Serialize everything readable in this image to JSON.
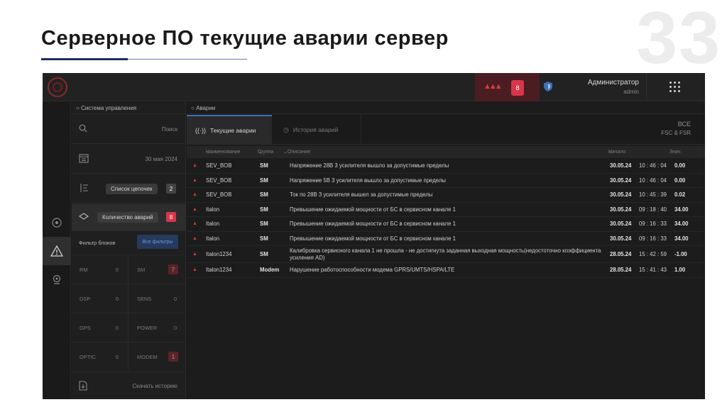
{
  "slide": {
    "title": "Серверное ПО текущие аварии сервер",
    "number": "33"
  },
  "topbar": {
    "alarm_count": "8",
    "user_name": "Администратор",
    "user_role": "admin"
  },
  "sidebar": {
    "header": "Система управления",
    "search_label": "Поиск",
    "date": "30 мая 2024",
    "chain_list_label": "Список цепочек",
    "chain_list_count": "2",
    "alarm_count_label": "Количество аварий",
    "alarm_count_value": "8",
    "block_filter_label": "Фильтр блоков",
    "all_filters_label": "Все фильтры",
    "blocks": [
      {
        "name": "RM",
        "value": "0"
      },
      {
        "name": "SM",
        "value": "7"
      },
      {
        "name": "DSP",
        "value": "0"
      },
      {
        "name": "SENS",
        "value": "0"
      },
      {
        "name": "GPS",
        "value": "0"
      },
      {
        "name": "POWER",
        "value": "0"
      },
      {
        "name": "OPTIC",
        "value": "0"
      },
      {
        "name": "MODEM",
        "value": "1"
      }
    ],
    "download_history_label": "Скачать историю"
  },
  "main": {
    "header": "Аварии",
    "tab_current": "Текущие аварии",
    "tab_history": "История аварий",
    "filter_line1": "ВСЕ",
    "filter_line2": "FSC & FSR",
    "columns": {
      "name": "Наименование",
      "group": "Группа",
      "description": "Описание",
      "start": "Начало",
      "value": "Знач."
    },
    "rows": [
      {
        "name": "SEV_BOB",
        "group": "SM",
        "description": "Напряжение 28В 3 усилителя вышло за допустимые пределы",
        "date": "30.05.24",
        "time": "10 : 46 : 04",
        "value": "0.00"
      },
      {
        "name": "SEV_BOB",
        "group": "SM",
        "description": "Напряжение 5В 3 усилителя вышло за допустимые пределы",
        "date": "30.05.24",
        "time": "10 : 46 : 04",
        "value": "0.00"
      },
      {
        "name": "SEV_BOB",
        "group": "SM",
        "description": "Ток по 28В 3 усилителя вышел за допустимые пределы",
        "date": "30.05.24",
        "time": "10 : 45 : 39",
        "value": "0.02"
      },
      {
        "name": "Italon",
        "group": "SM",
        "description": "Превышение ожидаемой мощности от БС в сервисном канале 1",
        "date": "30.05.24",
        "time": "09 : 18 : 40",
        "value": "34.00"
      },
      {
        "name": "Italon",
        "group": "SM",
        "description": "Превышение ожидаемой мощности от БС в сервисном канале 1",
        "date": "30.05.24",
        "time": "09 : 16 : 33",
        "value": "34.00"
      },
      {
        "name": "Italon",
        "group": "SM",
        "description": "Превышение ожидаемой мощности от БС в сервисном канале 1",
        "date": "30.05.24",
        "time": "09 : 16 : 33",
        "value": "34.00"
      },
      {
        "name": "Italon1234",
        "group": "SM",
        "description": "Калибровка сервисного канала 1 не прошла - не достигнута заданная выходная мощность(недостоточно коэффициента усиления AD)",
        "date": "28.05.24",
        "time": "15 : 42 : 59",
        "value": "-1.00"
      },
      {
        "name": "Italon1234",
        "group": "Modem",
        "description": "Нарушение работоспособности модема GPRS/UMTS/HSPA/LTE",
        "date": "28.05.24",
        "time": "15 : 41 : 43",
        "value": "1.00"
      }
    ]
  }
}
